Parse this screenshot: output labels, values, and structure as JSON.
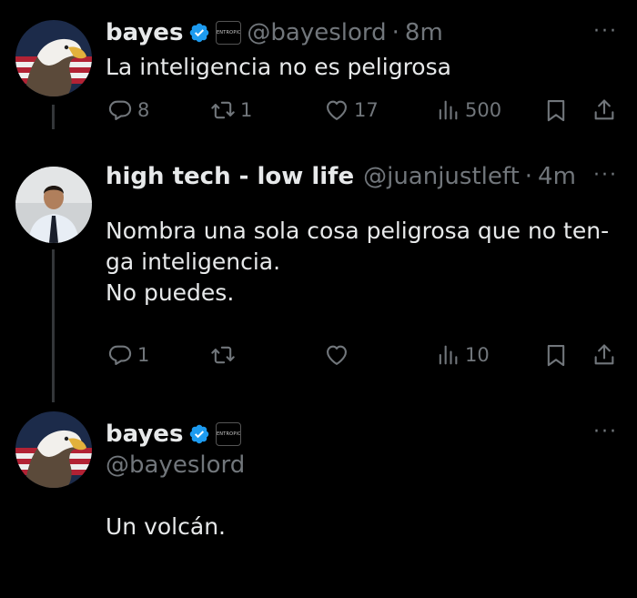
{
  "tweets": [
    {
      "name": "bayes",
      "affiliate": "ENTROPIC",
      "handle": "@bayeslord",
      "time": "8m",
      "text_lines": [
        "La inteligencia no es peligrosa"
      ],
      "stats": {
        "replies": "8",
        "retweets": "1",
        "likes": "17",
        "views": "500"
      }
    },
    {
      "name": "high tech - low life",
      "handle": "@juanjustleft",
      "time": "4m",
      "text_lines": [
        "Nombra una sola cosa peligrosa que no ten-",
        "ga inteligencia.",
        "No puedes."
      ],
      "stats": {
        "replies": "1",
        "retweets": "",
        "likes": "",
        "views": "10"
      }
    },
    {
      "name": "bayes",
      "affiliate": "ENTROPIC",
      "handle": "@bayeslord",
      "text_lines": [
        "Un volcán."
      ]
    }
  ],
  "separator": "·",
  "more_label": "···",
  "colors": {
    "background": "#000000",
    "text": "#e7e9ea",
    "muted": "#71767b",
    "verified": "#1d9bf0",
    "thread_line": "#333639"
  },
  "icons": [
    "verified-badge-icon",
    "reply-icon",
    "retweet-icon",
    "like-icon",
    "views-icon",
    "bookmark-icon",
    "share-icon",
    "more-icon"
  ]
}
